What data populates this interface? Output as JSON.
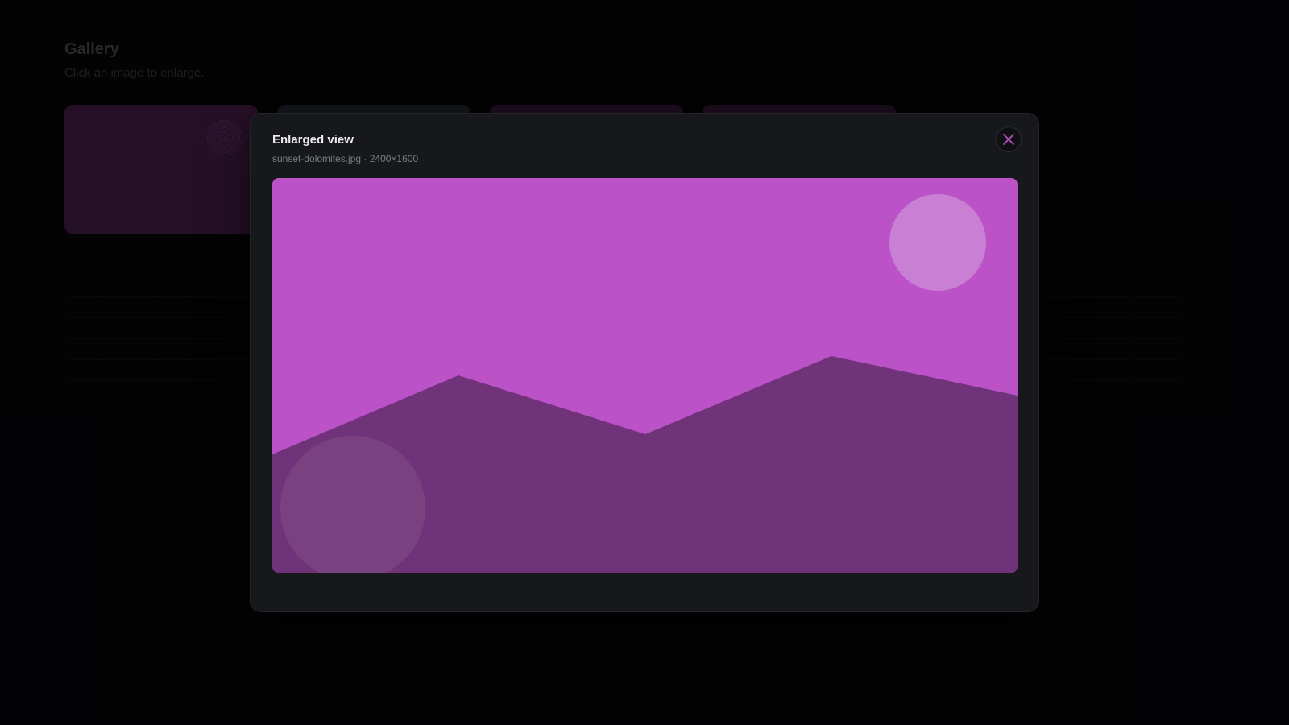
{
  "gallery": {
    "title": "Gallery",
    "subtitle": "Click an image to enlarge.",
    "thumbnails": [
      {
        "color": "#3b1a3d"
      },
      {
        "color": "#1c2128"
      },
      {
        "color": "#2d1530"
      },
      {
        "color": "#2d1530"
      }
    ]
  },
  "modal": {
    "title": "Enlarged view",
    "meta": "sunset-dolomites.jpg · 2400×1600",
    "close_icon": "close-icon",
    "image": {
      "sky_color": "#bb52c7",
      "mountain_color": "#70337a",
      "sun_color": "#c97fd4",
      "orb_color": "#7a4180"
    }
  },
  "colors": {
    "background": "#050507",
    "modal_bg": "#17181c",
    "accent": "#bb52c7"
  }
}
